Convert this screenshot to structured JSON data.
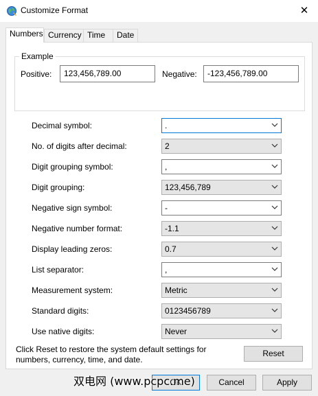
{
  "window": {
    "title": "Customize Format",
    "close_glyph": "✕"
  },
  "tabs": [
    "Numbers",
    "Currency",
    "Time",
    "Date"
  ],
  "example": {
    "group_label": "Example",
    "positive_label": "Positive:",
    "positive_value": "123,456,789.00",
    "negative_label": "Negative:",
    "negative_value": "-123,456,789.00"
  },
  "settings": [
    {
      "label": "Decimal symbol:",
      "value": "."
    },
    {
      "label": "No. of digits after decimal:",
      "value": "2"
    },
    {
      "label": "Digit grouping symbol:",
      "value": ","
    },
    {
      "label": "Digit grouping:",
      "value": "123,456,789"
    },
    {
      "label": "Negative sign symbol:",
      "value": "-"
    },
    {
      "label": "Negative number format:",
      "value": "-1.1"
    },
    {
      "label": "Display leading zeros:",
      "value": "0.7"
    },
    {
      "label": "List separator:",
      "value": ","
    },
    {
      "label": "Measurement system:",
      "value": "Metric"
    },
    {
      "label": "Standard digits:",
      "value": "0123456789"
    },
    {
      "label": "Use native digits:",
      "value": "Never"
    }
  ],
  "note": "Click Reset to restore the system default settings for numbers, currency, time, and date.",
  "buttons": {
    "reset": "Reset",
    "ok": "OK",
    "cancel": "Cancel",
    "apply": "Apply"
  },
  "watermark": "双电网 (www.pcpc.me)",
  "colors": {
    "focus_border": "#0078d7",
    "dialog_bg": "#f0f0f0",
    "dropdown_bg": "#e5e5e5"
  }
}
